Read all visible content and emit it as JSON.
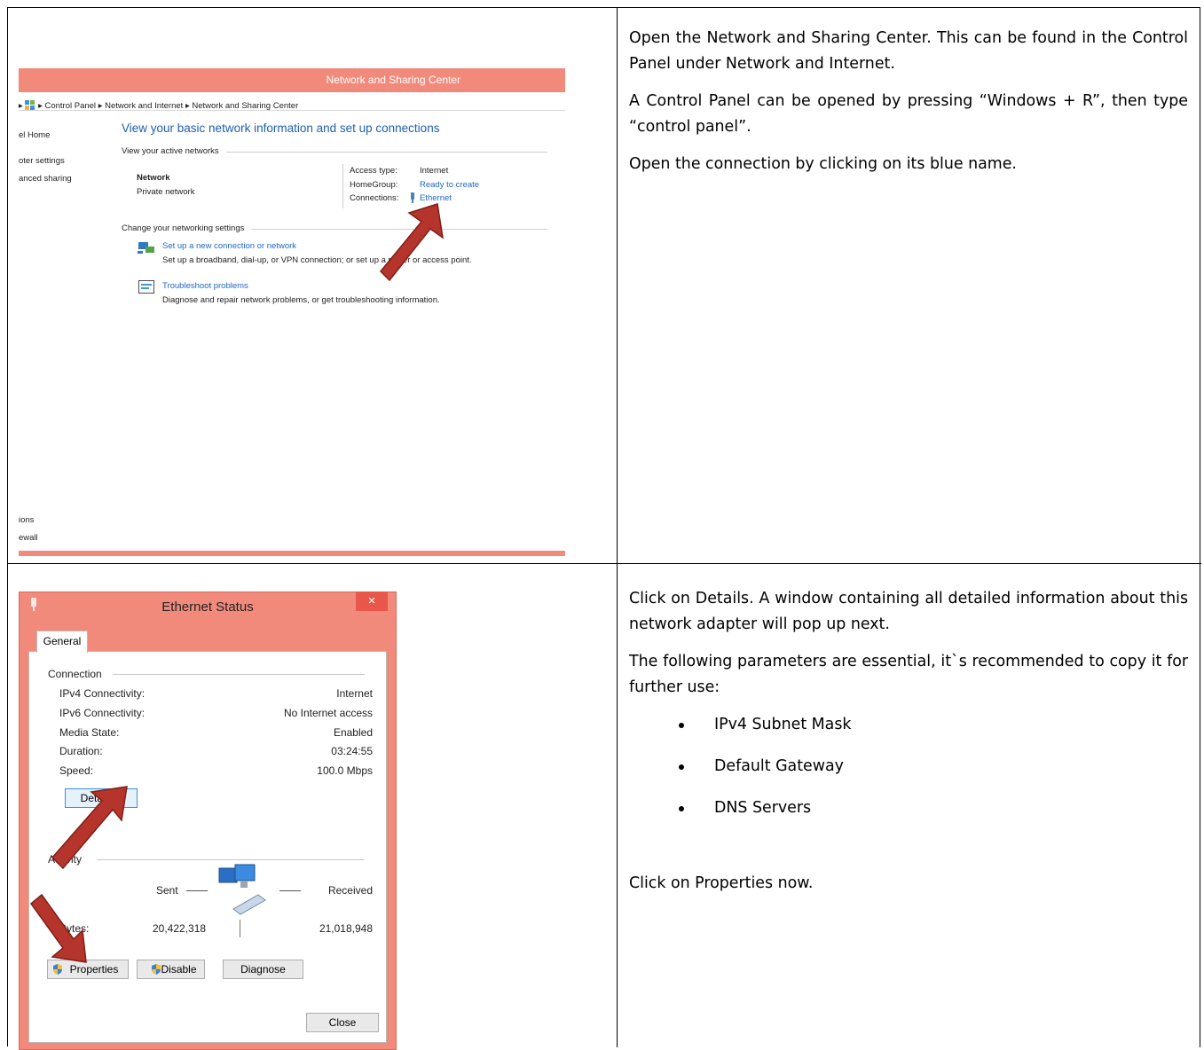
{
  "row1": {
    "window_title": "Network and Sharing Center",
    "breadcrumb": [
      "Control Panel",
      "Network and Internet",
      "Network and Sharing Center"
    ],
    "sidebar": [
      "el Home",
      "oter settings",
      "anced sharing"
    ],
    "sidebar_bottom": [
      "ions",
      "ewall"
    ],
    "heading": "View your basic network information and set up connections",
    "active_networks_label": "View your active networks",
    "network_name": "Network",
    "network_type": "Private network",
    "access_type_label": "Access type:",
    "access_type_value": "Internet",
    "homegroup_label": "HomeGroup:",
    "homegroup_value": "Ready to create",
    "connections_label": "Connections:",
    "connections_value": "Ethernet",
    "change_settings_label": "Change your networking settings",
    "setup_link": "Set up a new connection or network",
    "setup_desc": "Set up a broadband, dial-up, or VPN connection; or set up a router or access point.",
    "troubleshoot_link": "Troubleshoot problems",
    "troubleshoot_desc": "Diagnose and repair network problems, or get troubleshooting information.",
    "instructions": [
      "Open the Network and Sharing Center. This can be found in the Control Panel under Network and Internet.",
      "A Control Panel can be opened by pressing “Windows + R”, then type “control panel”.",
      "Open the connection by clicking on its blue name."
    ]
  },
  "row2": {
    "window_title": "Ethernet Status",
    "close_glyph": "×",
    "tab": "General",
    "connection_label": "Connection",
    "fields": [
      {
        "label": "IPv4 Connectivity:",
        "value": "Internet"
      },
      {
        "label": "IPv6 Connectivity:",
        "value": "No Internet access"
      },
      {
        "label": "Media State:",
        "value": "Enabled"
      },
      {
        "label": "Duration:",
        "value": "03:24:55"
      },
      {
        "label": "Speed:",
        "value": "100.0 Mbps"
      }
    ],
    "details_button": "Details...",
    "activity_label": "Activity",
    "sent_label": "Sent",
    "received_label": "Received",
    "bytes_label": "Bytes:",
    "bytes_sent": "20,422,318",
    "bytes_received": "21,018,948",
    "properties_button": "Properties",
    "disable_button": "Disable",
    "diagnose_button": "Diagnose",
    "close_button": "Close",
    "instructions_top": [
      "Click on Details. A window containing all detailed information about this network adapter will pop up next.",
      "The following parameters are essential, it`s recommended to copy it for further use:"
    ],
    "bullets": [
      "IPv4 Subnet Mask",
      "Default Gateway",
      "DNS Servers"
    ],
    "instructions_bottom": "Click on Properties now."
  },
  "colors": {
    "accent": "#f28a7c",
    "link": "#1e66c8",
    "arrow": "#b5352c",
    "close": "#e8574a"
  }
}
